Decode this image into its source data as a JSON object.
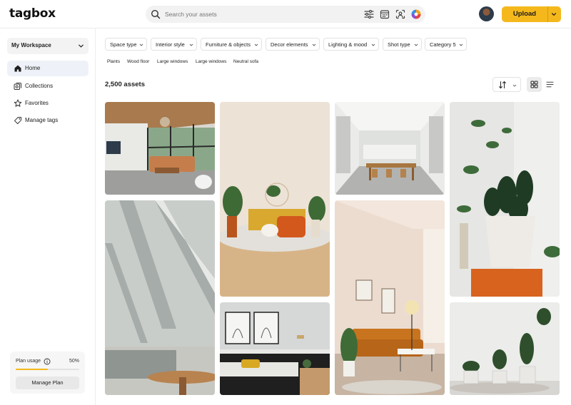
{
  "app": {
    "name": "tagbox"
  },
  "header": {
    "search_placeholder": "Search your assets",
    "icons": [
      "filter-sliders-icon",
      "calendar-icon",
      "face-scan-icon",
      "color-wheel-icon"
    ],
    "upload_label": "Upload"
  },
  "sidebar": {
    "workspace_label": "My Workspace",
    "items": [
      {
        "label": "Home",
        "icon": "home-icon",
        "active": true
      },
      {
        "label": "Collections",
        "icon": "collections-icon",
        "active": false
      },
      {
        "label": "Favorites",
        "icon": "star-icon",
        "active": false
      },
      {
        "label": "Manage tags",
        "icon": "tag-icon",
        "active": false
      }
    ],
    "plan": {
      "label": "Plan usage",
      "percent_label": "50%",
      "usage_fraction": 0.5,
      "button_label": "Manage Plan"
    }
  },
  "filters": [
    {
      "label": "Space type"
    },
    {
      "label": "Interior style"
    },
    {
      "label": "Furniture & objects"
    },
    {
      "label": "Decor elements"
    },
    {
      "label": "Lighting & mood"
    },
    {
      "label": "Shot type"
    },
    {
      "label": "Category 5"
    }
  ],
  "tags": [
    "Plants",
    "Wood floor",
    "Large windows",
    "Large windows",
    "Neutral sofa"
  ],
  "results": {
    "count_label": "2,500 assets"
  },
  "view": {
    "mode": "grid"
  },
  "colors": {
    "accent": "#f5b81c",
    "active_nav": "#eef2f8"
  }
}
